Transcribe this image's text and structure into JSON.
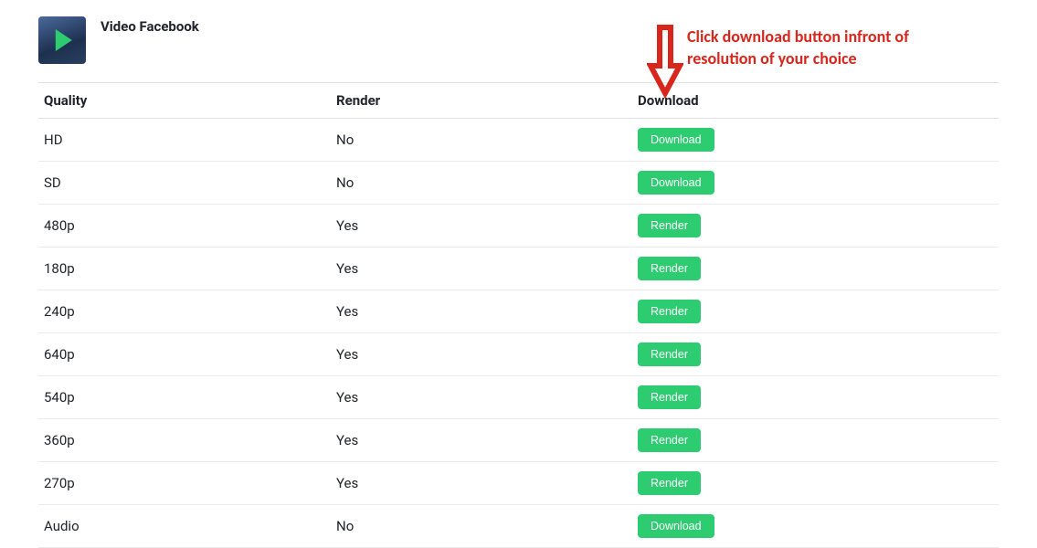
{
  "video": {
    "title": "Video Facebook"
  },
  "table": {
    "headers": {
      "quality": "Quality",
      "render": "Render",
      "download": "Download"
    },
    "rows": [
      {
        "quality": "HD",
        "render": "No",
        "button": "Download"
      },
      {
        "quality": "SD",
        "render": "No",
        "button": "Download"
      },
      {
        "quality": "480p",
        "render": "Yes",
        "button": "Render"
      },
      {
        "quality": "180p",
        "render": "Yes",
        "button": "Render"
      },
      {
        "quality": "240p",
        "render": "Yes",
        "button": "Render"
      },
      {
        "quality": "640p",
        "render": "Yes",
        "button": "Render"
      },
      {
        "quality": "540p",
        "render": "Yes",
        "button": "Render"
      },
      {
        "quality": "360p",
        "render": "Yes",
        "button": "Render"
      },
      {
        "quality": "270p",
        "render": "Yes",
        "button": "Render"
      },
      {
        "quality": "Audio",
        "render": "No",
        "button": "Download"
      }
    ]
  },
  "annotation": {
    "text": "Click download button infront of resolution of your choice",
    "color": "#d9261c"
  },
  "colors": {
    "button_bg": "#2ecc71",
    "button_fg": "#ffffff"
  }
}
